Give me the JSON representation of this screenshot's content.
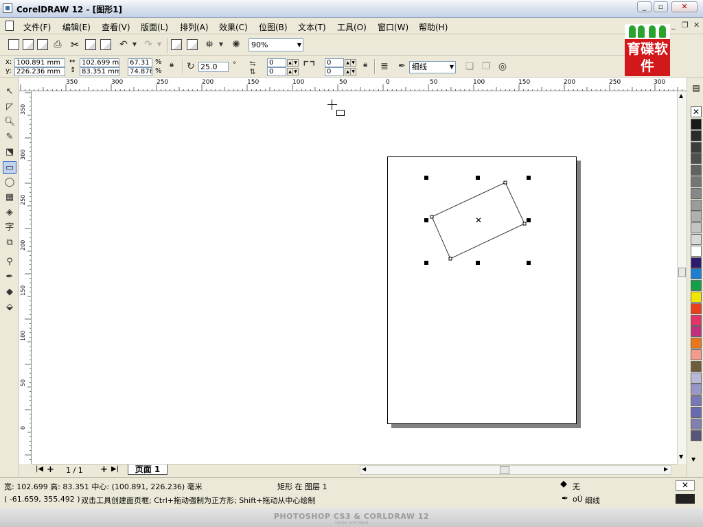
{
  "window": {
    "title": "CorelDRAW 12 - [图形1]",
    "min": "_",
    "max": "▫",
    "close": "✕"
  },
  "menu": [
    {
      "label": "文件(F)"
    },
    {
      "label": "编辑(E)"
    },
    {
      "label": "查看(V)"
    },
    {
      "label": "版面(L)"
    },
    {
      "label": "排列(A)"
    },
    {
      "label": "效果(C)"
    },
    {
      "label": "位图(B)"
    },
    {
      "label": "文本(T)"
    },
    {
      "label": "工具(O)"
    },
    {
      "label": "窗口(W)"
    },
    {
      "label": "帮助(H)"
    }
  ],
  "toolbar": {
    "zoom": "90%"
  },
  "properties": {
    "x_label": "x:",
    "x": "100.891 mm",
    "y_label": "y:",
    "y": "226.236 mm",
    "width": "102.699 mm",
    "height": "83.351 mm",
    "scale_x": "67.31",
    "scale_y": "74.876",
    "percent": "%",
    "angle": "25.0",
    "degree": "°",
    "corner1": "0",
    "corner2": "0",
    "corner3": "0",
    "corner4": "0",
    "outline": "细线"
  },
  "logo": {
    "text": "育碟软件",
    "color": "#d2181b"
  },
  "ruler": {
    "top": [
      "350",
      "300",
      "250",
      "200",
      "150",
      "100",
      "50",
      "0",
      "50",
      "100",
      "150",
      "200",
      "250",
      "300"
    ],
    "left": [
      "350",
      "300",
      "250",
      "200",
      "150",
      "100",
      "50",
      "0"
    ],
    "corner": "☒"
  },
  "page_nav": {
    "counter": "1 / 1",
    "tab": "页面 1"
  },
  "status": {
    "size": "宽: 102.699 高: 83.351 中心: (100.891, 226.236) 毫米",
    "object": "矩形 在 图层 1",
    "coords": "( -61.659, 355.492 )",
    "hint": "双击工具创建面页框; Ctrl+拖动强制为正方形; Shift+拖动从中心绘制",
    "fill": "无",
    "outline": "细线",
    "outline_prefix": "oÚ"
  },
  "footer": {
    "text": "PHOTOSHOP CS3 & CORLDRAW 12",
    "sub": "YUDIE SOFTWAR"
  },
  "palette": [
    "#1a1a1a",
    "#2b2b2b",
    "#3d3d3d",
    "#4f4f4f",
    "#626262",
    "#757575",
    "#888888",
    "#9c9c9c",
    "#b0b0b0",
    "#c4c4c4",
    "#d8d8d8",
    "#ffffff",
    "#2e1a6e",
    "#1e7fd0",
    "#13a04a",
    "#f2e600",
    "#e8401c",
    "#e23468",
    "#c0307e",
    "#e8771a",
    "#f29c8c",
    "#6e5a3c",
    "#b8b8d8",
    "#9898c8",
    "#7878b8",
    "#6a6ab0",
    "#8080b0",
    "#56567a"
  ]
}
